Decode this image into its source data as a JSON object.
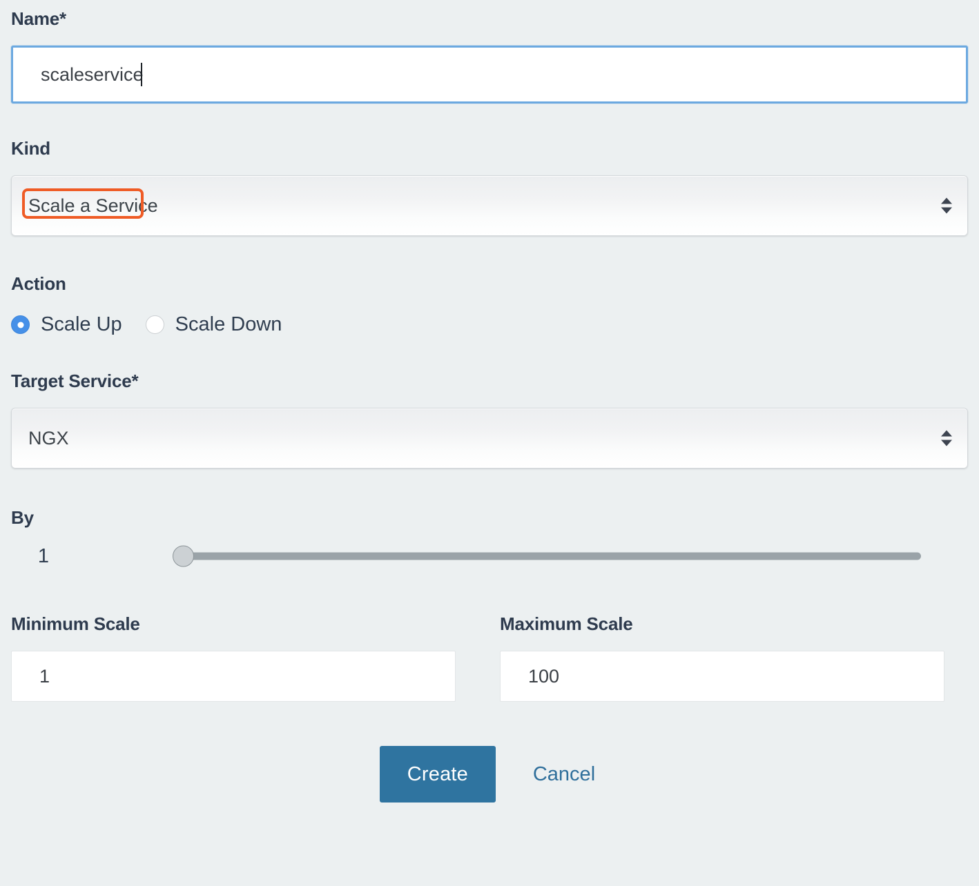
{
  "form": {
    "name": {
      "label": "Name*",
      "value": "scaleservice",
      "placeholder": ""
    },
    "kind": {
      "label": "Kind",
      "selected": "Scale a Service",
      "annotation_color": "#ef5b25",
      "dropdown_icon": "updown-arrows-icon"
    },
    "action": {
      "label": "Action",
      "options": [
        {
          "label": "Scale Up",
          "selected": true
        },
        {
          "label": "Scale Down",
          "selected": false
        }
      ]
    },
    "target_service": {
      "label": "Target Service*",
      "selected": "NGX",
      "dropdown_icon": "updown-arrows-icon"
    },
    "by": {
      "label": "By",
      "value": "1",
      "slider": {
        "min": 1,
        "max": 100,
        "current": 1
      }
    },
    "minimum_scale": {
      "label": "Minimum Scale",
      "value": "1",
      "placeholder": ""
    },
    "maximum_scale": {
      "label": "Maximum Scale",
      "value": "100",
      "placeholder": ""
    }
  },
  "footer": {
    "create_label": "Create",
    "cancel_label": "Cancel"
  },
  "colors": {
    "page_background": "#ecf0f1",
    "label_text": "#2e3b4e",
    "primary_button": "#2f74a0",
    "link": "#2f6f9b",
    "focus_border": "#6ca9e0",
    "radio_selected": "#4690e8",
    "annotation": "#ef5b25",
    "slider_track": "#9aa3a8",
    "slider_thumb": "#ccd1d4"
  }
}
